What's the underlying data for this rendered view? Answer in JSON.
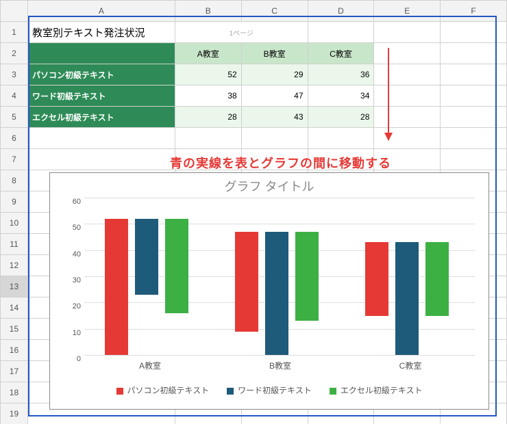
{
  "columns": [
    "",
    "A",
    "B",
    "C",
    "D",
    "E",
    "F"
  ],
  "row_numbers": [
    1,
    2,
    3,
    4,
    5,
    6,
    7,
    8,
    9,
    10,
    11,
    12,
    13,
    14,
    15,
    16,
    17,
    18,
    19
  ],
  "title": "教室別テキスト発注状況",
  "page_label": "1ページ",
  "table": {
    "col_headers": [
      "A教室",
      "B教室",
      "C教室"
    ],
    "row_headers": [
      "パソコン初級テキスト",
      "ワード初級テキスト",
      "エクセル初級テキスト"
    ],
    "values": [
      [
        52,
        29,
        36
      ],
      [
        38,
        47,
        34
      ],
      [
        28,
        43,
        28
      ]
    ]
  },
  "annotation": "青の実線を表とグラフの間に移動する",
  "chart_title": "グラフ タイトル",
  "chart_data": {
    "type": "bar",
    "categories": [
      "A教室",
      "B教室",
      "C教室"
    ],
    "series": [
      {
        "name": "パソコン初級テキスト",
        "values": [
          52,
          38,
          28
        ],
        "color": "#e53935"
      },
      {
        "name": "ワード初級テキスト",
        "values": [
          29,
          47,
          43
        ],
        "color": "#1e5a7a"
      },
      {
        "name": "エクセル初級テキスト",
        "values": [
          36,
          34,
          28
        ],
        "color": "#3cb043"
      }
    ],
    "title": "グラフ タイトル",
    "xlabel": "",
    "ylabel": "",
    "ylim": [
      0,
      60
    ],
    "yticks": [
      0,
      10,
      20,
      30,
      40,
      50,
      60
    ]
  }
}
